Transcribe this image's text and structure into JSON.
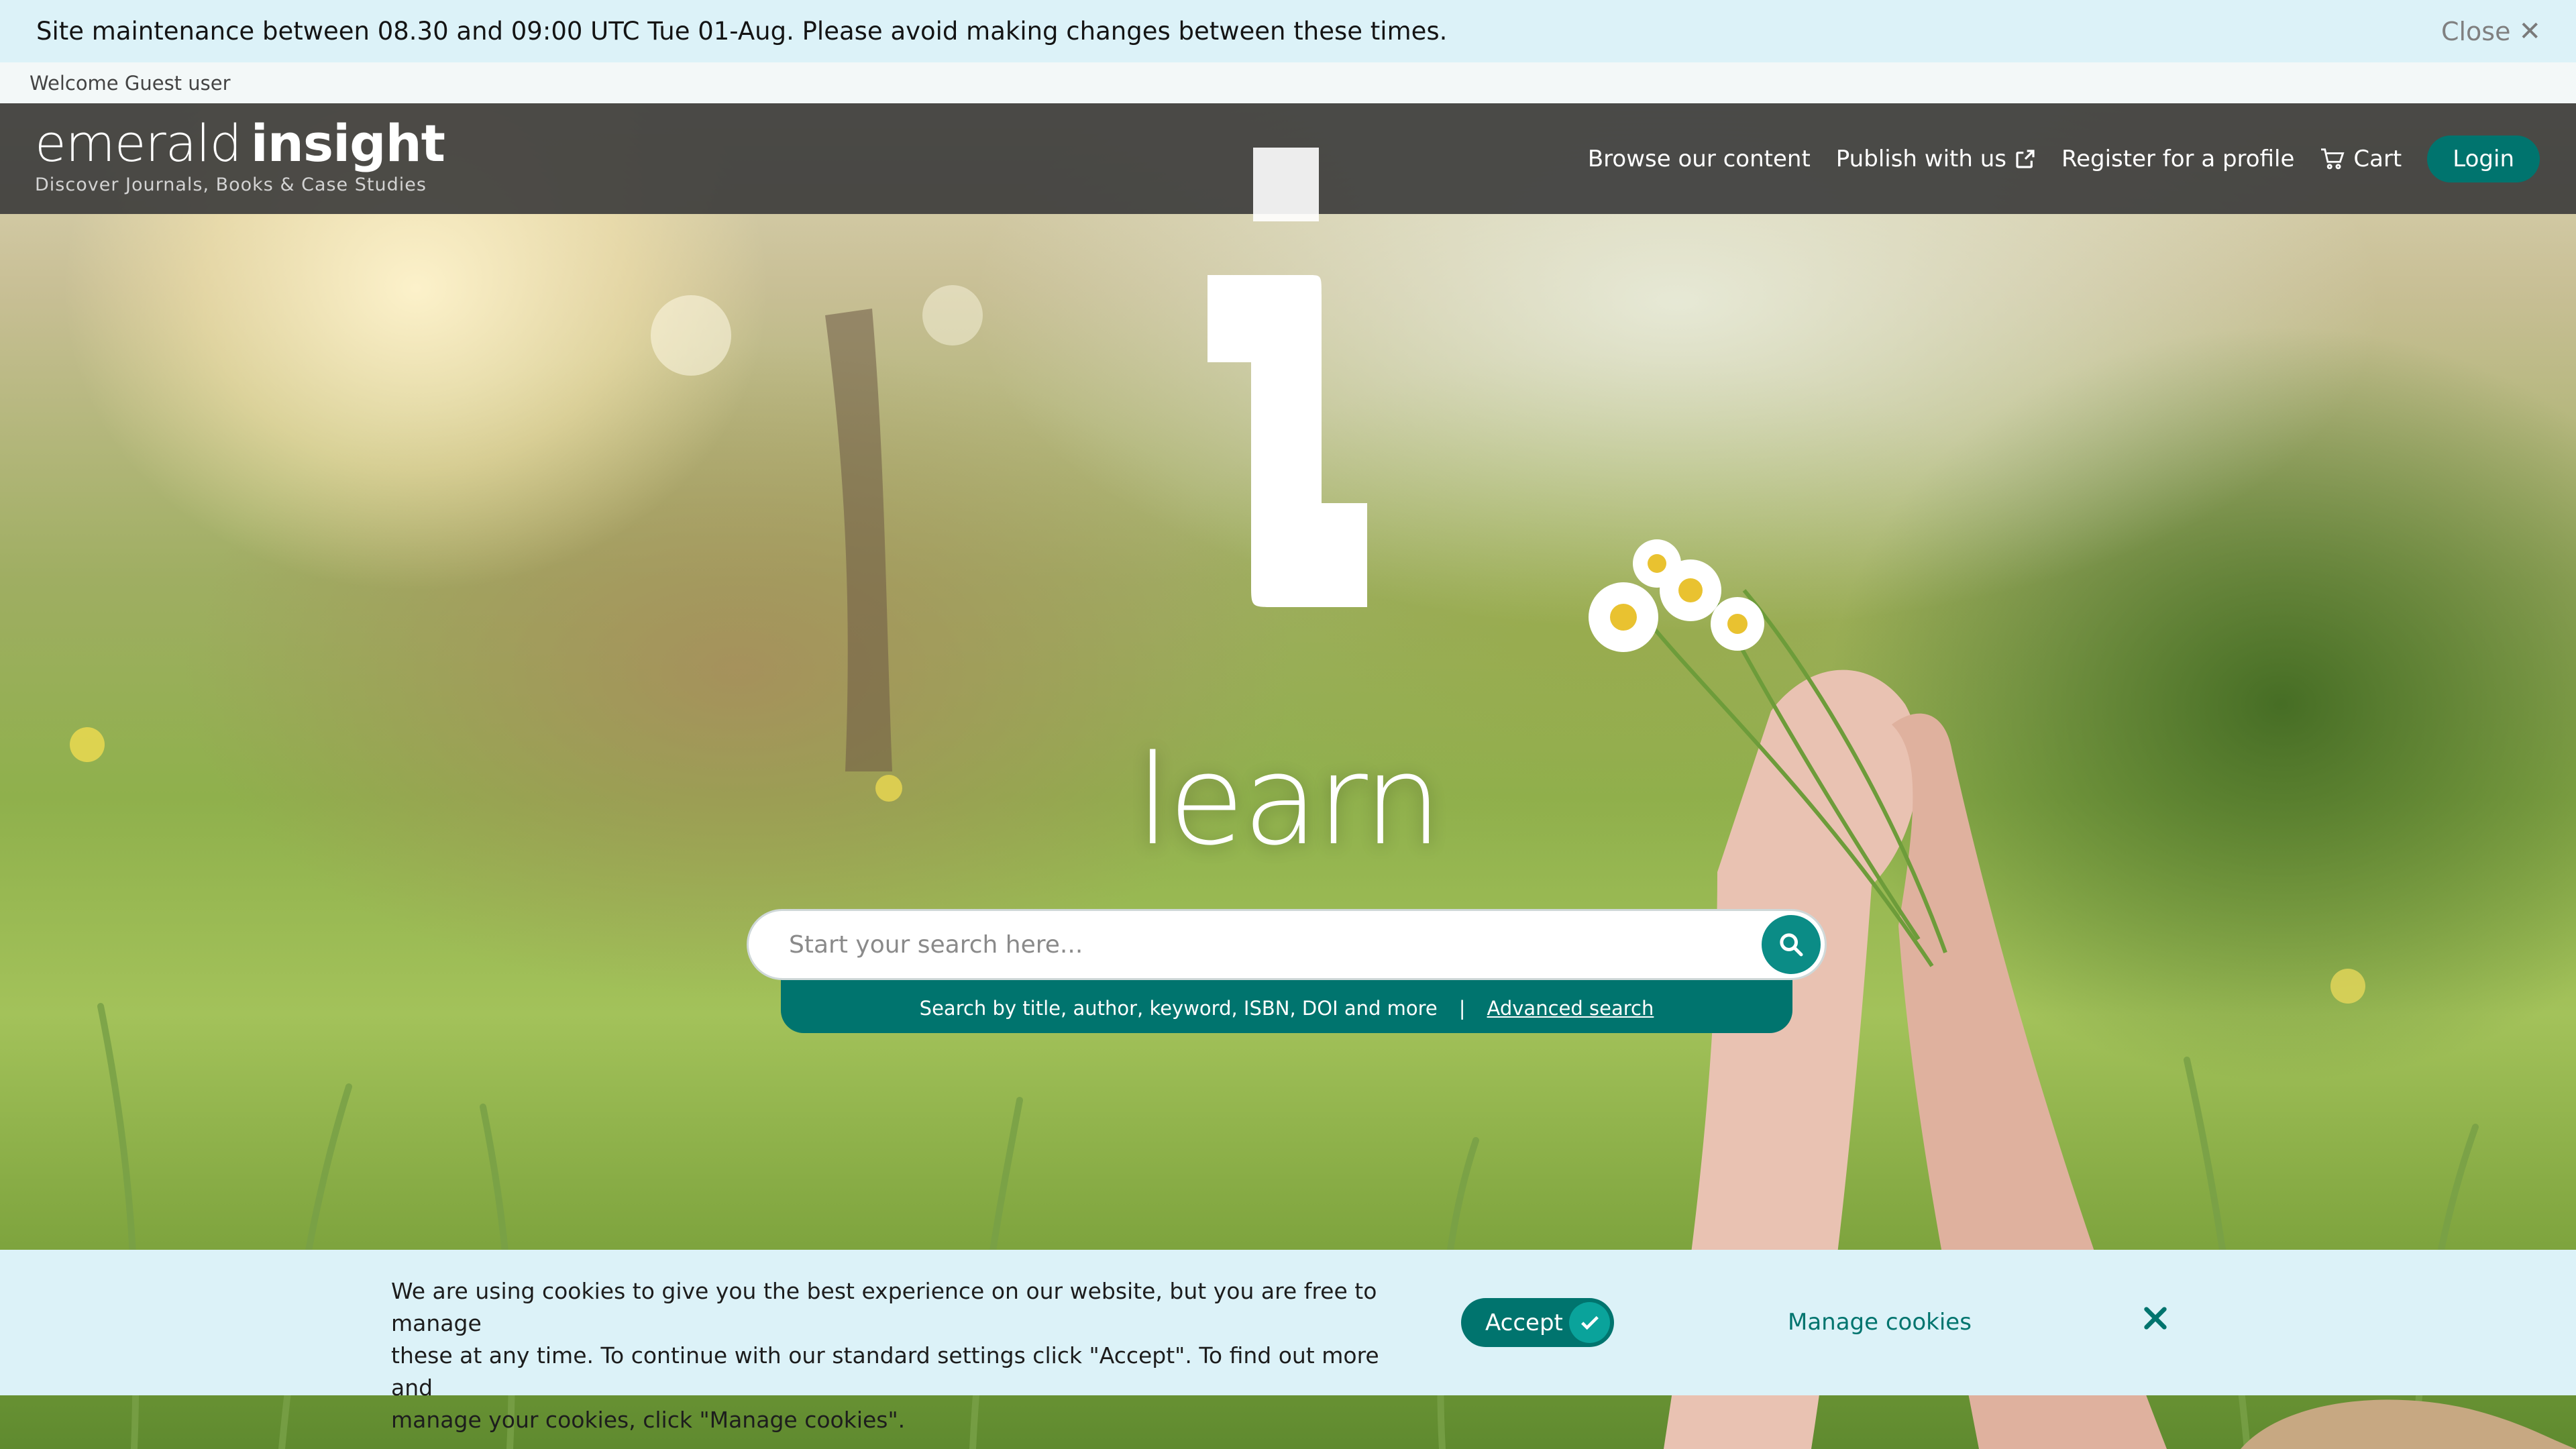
{
  "maintenance_banner": {
    "message": "Site maintenance between 08.30 and 09:00 UTC Tue 01-Aug. Please avoid making changes between these times.",
    "close_label": "Close",
    "close_icon": "close-icon"
  },
  "welcome": {
    "text": "Welcome Guest user"
  },
  "header": {
    "brand_light": "emerald",
    "brand_bold": "insight",
    "tagline": "Discover Journals, Books & Case Studies",
    "nav": {
      "browse": "Browse our content",
      "publish": "Publish with us",
      "publish_icon": "external-link-icon",
      "register": "Register for a profile",
      "cart": "Cart",
      "cart_icon": "cart-icon",
      "login": "Login"
    }
  },
  "hero": {
    "headline": "learn",
    "logo_letter_icon": "emerald-i-logo-icon"
  },
  "search": {
    "placeholder": "Start your search here...",
    "value": "",
    "search_icon": "search-icon",
    "helper_text": "Search by title, author, keyword, ISBN, DOI and more",
    "separator": "|",
    "advanced_label": "Advanced search"
  },
  "cookie_banner": {
    "line1": "We are using cookies to give you the best experience on our website, but you are free to manage",
    "line2": "these at any time. To continue with our standard settings click \"Accept\". To find out more and",
    "line3": "manage your cookies, click \"Manage cookies\".",
    "accept_label": "Accept",
    "accept_icon": "check-icon",
    "manage_label": "Manage cookies",
    "dismiss_icon": "close-icon"
  },
  "colors": {
    "brand_teal": "#00746e",
    "banner_bg": "#dcf2f8",
    "nav_bg": "#3a3a3a"
  }
}
